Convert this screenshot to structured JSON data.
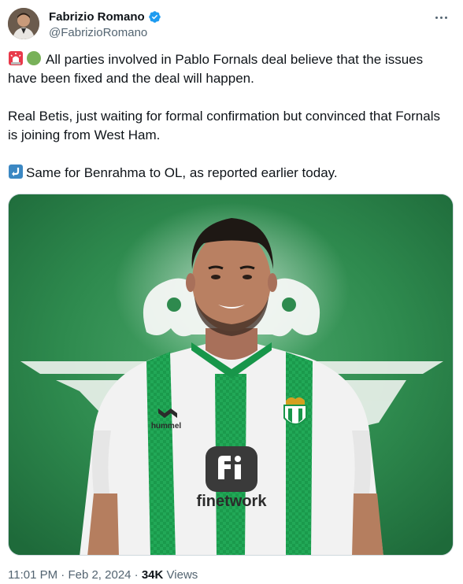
{
  "author": {
    "display_name": "Fabrizio Romano",
    "handle": "@FabrizioRomano",
    "verified": true
  },
  "icons": {
    "avatar": "profile-photo",
    "verified": "verified-badge-icon",
    "more": "more-options-icon",
    "emoji_1": "police-siren-emoji",
    "emoji_2": "green-circle-emoji",
    "emoji_3": "right-arrow-curving-left-emoji"
  },
  "tweet": {
    "para1": "All parties involved in Pablo Fornals deal believe that the issues have been fixed and the deal will happen.",
    "para2": "Real Betis, just waiting for formal confirmation but convinced that Fornals is joining from West Ham.",
    "para3": "Same for Benrahma to OL, as reported earlier today."
  },
  "media": {
    "kit_brand": "hummel",
    "sponsor": "finetwork"
  },
  "meta": {
    "time": "11:01 PM",
    "separator": "·",
    "date": "Feb 2, 2024",
    "views_count": "34K",
    "views_label": "Views"
  },
  "colors": {
    "verified_blue": "#1d9bf0",
    "secondary_text": "#536471",
    "betis_green": "#0a9a4a"
  }
}
